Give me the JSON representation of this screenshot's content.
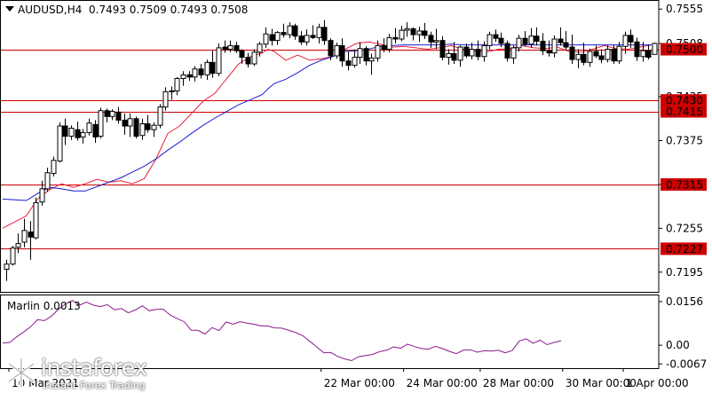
{
  "header": {
    "symbol": "AUDUSD,H4",
    "ohlc": "0.7493 0.7509 0.7493 0.7508"
  },
  "indicator": {
    "label": "Marlin 0.0013"
  },
  "logo": {
    "name": "instaforex",
    "tagline": "Instant Forex Trading"
  },
  "colors": {
    "background": "#ffffff",
    "axis": "#000000",
    "candle_up": "#ffffff",
    "candle_down": "#000000",
    "level_line": "#cc0000",
    "level_label_bg": "#cc0000",
    "ma_fast": "#e8213a",
    "ma_slow": "#1a1ad6",
    "oscillator": "#8b1a8b"
  },
  "chart_data": [
    {
      "type": "candlestick",
      "title": "AUDUSD,H4",
      "ylim": [
        0.7168,
        0.7565
      ],
      "price_ticks": [
        "0.7555",
        "0.7435",
        "0.7375",
        "0.7315",
        "0.7255",
        "0.7195"
      ],
      "x_ticks": [
        {
          "label": "10 Mar 2021",
          "at": 0
        },
        {
          "label": "22 Mar 00:00",
          "at": 53
        },
        {
          "label": "24 Mar 00:00",
          "at": 67
        },
        {
          "label": "28 Mar 00:00",
          "at": 80
        },
        {
          "label": "30 Mar 00:00",
          "at": 94
        },
        {
          "label": "1 Apr 00:00",
          "at": 108
        }
      ],
      "levels": [
        {
          "value": 0.75,
          "label": "0.7500"
        },
        {
          "value": 0.743,
          "label": "0.7430"
        },
        {
          "value": 0.7415,
          "label": "0.7415"
        },
        {
          "value": 0.7315,
          "label": "0.7315"
        },
        {
          "value": 0.7227,
          "label": "0.7227"
        }
      ],
      "current_price": {
        "value": 0.7508,
        "label": "0.7508"
      },
      "candles": [
        [
          0.7199,
          0.7212,
          0.7183,
          0.7206
        ],
        [
          0.7206,
          0.7231,
          0.7204,
          0.7228
        ],
        [
          0.7229,
          0.7248,
          0.7221,
          0.7234
        ],
        [
          0.7236,
          0.7268,
          0.7229,
          0.7252
        ],
        [
          0.725,
          0.7265,
          0.7212,
          0.7243
        ],
        [
          0.7242,
          0.7297,
          0.724,
          0.729
        ],
        [
          0.7291,
          0.732,
          0.7286,
          0.7309
        ],
        [
          0.7309,
          0.7338,
          0.7305,
          0.7331
        ],
        [
          0.733,
          0.7353,
          0.7326,
          0.7348
        ],
        [
          0.7347,
          0.74,
          0.7345,
          0.7395
        ],
        [
          0.7395,
          0.7405,
          0.7369,
          0.7381
        ],
        [
          0.7381,
          0.7396,
          0.7376,
          0.7392
        ],
        [
          0.739,
          0.7401,
          0.7375,
          0.7379
        ],
        [
          0.738,
          0.7391,
          0.7371,
          0.7386
        ],
        [
          0.7386,
          0.7405,
          0.7382,
          0.7399
        ],
        [
          0.7397,
          0.7403,
          0.7372,
          0.738
        ],
        [
          0.7381,
          0.742,
          0.7378,
          0.7416
        ],
        [
          0.7416,
          0.7419,
          0.74,
          0.7408
        ],
        [
          0.7408,
          0.7418,
          0.7403,
          0.7415
        ],
        [
          0.7414,
          0.7421,
          0.7398,
          0.7403
        ],
        [
          0.7403,
          0.7412,
          0.7383,
          0.7395
        ],
        [
          0.7395,
          0.7412,
          0.738,
          0.7405
        ],
        [
          0.7405,
          0.7408,
          0.7378,
          0.7381
        ],
        [
          0.7382,
          0.7405,
          0.7376,
          0.7398
        ],
        [
          0.7398,
          0.741,
          0.7386,
          0.739
        ],
        [
          0.739,
          0.74,
          0.738,
          0.7396
        ],
        [
          0.7396,
          0.7425,
          0.7392,
          0.7421
        ],
        [
          0.7421,
          0.7448,
          0.7416,
          0.7442
        ],
        [
          0.7442,
          0.7449,
          0.7431,
          0.7443
        ],
        [
          0.7443,
          0.7462,
          0.7437,
          0.746
        ],
        [
          0.746,
          0.747,
          0.745,
          0.7465
        ],
        [
          0.7465,
          0.747,
          0.7457,
          0.7462
        ],
        [
          0.7462,
          0.7477,
          0.7456,
          0.7473
        ],
        [
          0.7473,
          0.748,
          0.746,
          0.7465
        ],
        [
          0.7465,
          0.7486,
          0.7458,
          0.7482
        ],
        [
          0.7482,
          0.7498,
          0.7461,
          0.7467
        ],
        [
          0.7467,
          0.7508,
          0.7463,
          0.7502
        ],
        [
          0.7503,
          0.7512,
          0.7495,
          0.75
        ],
        [
          0.75,
          0.7512,
          0.7496,
          0.7505
        ],
        [
          0.7505,
          0.751,
          0.7495,
          0.7498
        ],
        [
          0.7498,
          0.75,
          0.748,
          0.7489
        ],
        [
          0.7489,
          0.7495,
          0.7475,
          0.748
        ],
        [
          0.748,
          0.75,
          0.7477,
          0.7496
        ],
        [
          0.7496,
          0.751,
          0.749,
          0.7507
        ],
        [
          0.7507,
          0.753,
          0.7502,
          0.7521
        ],
        [
          0.752,
          0.7528,
          0.7505,
          0.7512
        ],
        [
          0.7512,
          0.7525,
          0.7506,
          0.7523
        ],
        [
          0.7523,
          0.7535,
          0.7516,
          0.752
        ],
        [
          0.752,
          0.7537,
          0.7515,
          0.7532
        ],
        [
          0.7532,
          0.7535,
          0.7513,
          0.7518
        ],
        [
          0.7518,
          0.7525,
          0.7506,
          0.751
        ],
        [
          0.751,
          0.7527,
          0.7505,
          0.7519
        ],
        [
          0.7519,
          0.7533,
          0.7514,
          0.7516
        ],
        [
          0.7516,
          0.7535,
          0.7508,
          0.753
        ],
        [
          0.753,
          0.754,
          0.7506,
          0.7512
        ],
        [
          0.7512,
          0.7515,
          0.7485,
          0.7491
        ],
        [
          0.7491,
          0.7509,
          0.7487,
          0.7505
        ],
        [
          0.7505,
          0.7515,
          0.7476,
          0.7484
        ],
        [
          0.7484,
          0.7497,
          0.7471,
          0.7478
        ],
        [
          0.7478,
          0.75,
          0.7475,
          0.7489
        ],
        [
          0.7489,
          0.751,
          0.748,
          0.7501
        ],
        [
          0.7501,
          0.7504,
          0.7478,
          0.7484
        ],
        [
          0.7484,
          0.7494,
          0.7465,
          0.7488
        ],
        [
          0.7488,
          0.7512,
          0.7483,
          0.7505
        ],
        [
          0.7505,
          0.7515,
          0.7496,
          0.75
        ],
        [
          0.75,
          0.7521,
          0.7496,
          0.7516
        ],
        [
          0.7516,
          0.7529,
          0.7508,
          0.7514
        ],
        [
          0.7514,
          0.7532,
          0.7511,
          0.7526
        ],
        [
          0.7526,
          0.7537,
          0.7517,
          0.7528
        ],
        [
          0.7528,
          0.753,
          0.7512,
          0.752
        ],
        [
          0.752,
          0.7531,
          0.751,
          0.7525
        ],
        [
          0.7525,
          0.7536,
          0.7514,
          0.7519
        ],
        [
          0.7519,
          0.7524,
          0.7502,
          0.751
        ],
        [
          0.751,
          0.7528,
          0.75,
          0.7512
        ],
        [
          0.7512,
          0.7518,
          0.7485,
          0.7489
        ],
        [
          0.7489,
          0.75,
          0.7479,
          0.7494
        ],
        [
          0.7494,
          0.751,
          0.748,
          0.7485
        ],
        [
          0.7485,
          0.7505,
          0.7476,
          0.7503
        ],
        [
          0.7503,
          0.7508,
          0.7488,
          0.7491
        ],
        [
          0.7491,
          0.7509,
          0.7486,
          0.75
        ],
        [
          0.75,
          0.7512,
          0.7485,
          0.749
        ],
        [
          0.749,
          0.7511,
          0.7483,
          0.7505
        ],
        [
          0.7505,
          0.7524,
          0.75,
          0.752
        ],
        [
          0.752,
          0.7527,
          0.751,
          0.7515
        ],
        [
          0.7515,
          0.7523,
          0.7503,
          0.7508
        ],
        [
          0.7508,
          0.7512,
          0.7483,
          0.7488
        ],
        [
          0.7488,
          0.7505,
          0.748,
          0.7502
        ],
        [
          0.7502,
          0.752,
          0.7497,
          0.7515
        ],
        [
          0.7515,
          0.7525,
          0.7504,
          0.7507
        ],
        [
          0.7507,
          0.7529,
          0.7502,
          0.7518
        ],
        [
          0.7518,
          0.753,
          0.7505,
          0.7511
        ],
        [
          0.7511,
          0.7522,
          0.7492,
          0.7498
        ],
        [
          0.7498,
          0.7512,
          0.749,
          0.7495
        ],
        [
          0.7495,
          0.7519,
          0.7489,
          0.7514
        ],
        [
          0.7514,
          0.753,
          0.7505,
          0.7509
        ],
        [
          0.7509,
          0.7525,
          0.7498,
          0.7503
        ],
        [
          0.7503,
          0.752,
          0.748,
          0.7486
        ],
        [
          0.7486,
          0.75,
          0.7474,
          0.7493
        ],
        [
          0.7493,
          0.7509,
          0.7478,
          0.7482
        ],
        [
          0.7482,
          0.7501,
          0.7476,
          0.7497
        ],
        [
          0.7497,
          0.7505,
          0.7488,
          0.7491
        ],
        [
          0.7491,
          0.75,
          0.7481,
          0.7486
        ],
        [
          0.7486,
          0.7505,
          0.7482,
          0.75
        ],
        [
          0.75,
          0.7506,
          0.748,
          0.7484
        ],
        [
          0.7484,
          0.751,
          0.748,
          0.7504
        ],
        [
          0.7504,
          0.7524,
          0.7494,
          0.7519
        ],
        [
          0.7519,
          0.7527,
          0.7502,
          0.751
        ],
        [
          0.751,
          0.7516,
          0.7484,
          0.749
        ],
        [
          0.749,
          0.751,
          0.7483,
          0.7498
        ],
        [
          0.7498,
          0.7506,
          0.7486,
          0.7489
        ],
        [
          0.7493,
          0.7509,
          0.7493,
          0.7508
        ]
      ],
      "ma_fast": [
        [
          0,
          0.7255
        ],
        [
          8,
          0.7272
        ],
        [
          12,
          0.7296
        ],
        [
          16,
          0.7308
        ],
        [
          20,
          0.7316
        ],
        [
          24,
          0.7311
        ],
        [
          28,
          0.7316
        ],
        [
          32,
          0.7322
        ],
        [
          36,
          0.7318
        ],
        [
          40,
          0.732
        ],
        [
          44,
          0.7316
        ],
        [
          48,
          0.7323
        ],
        [
          52,
          0.735
        ],
        [
          56,
          0.7385
        ],
        [
          60,
          0.7395
        ],
        [
          64,
          0.7412
        ],
        [
          68,
          0.7429
        ],
        [
          72,
          0.744
        ],
        [
          76,
          0.746
        ],
        [
          80,
          0.748
        ],
        [
          84,
          0.749
        ],
        [
          88,
          0.7495
        ],
        [
          90,
          0.75
        ],
        [
          92,
          0.7497
        ],
        [
          96,
          0.7485
        ],
        [
          100,
          0.7492
        ],
        [
          104,
          0.7485
        ],
        [
          108,
          0.7487
        ],
        [
          112,
          0.749
        ],
        [
          116,
          0.75
        ],
        [
          120,
          0.7508
        ],
        [
          124,
          0.751
        ],
        [
          128,
          0.7507
        ],
        [
          132,
          0.7503
        ],
        [
          136,
          0.7504
        ],
        [
          140,
          0.7502
        ],
        [
          144,
          0.75
        ],
        [
          148,
          0.7502
        ],
        [
          152,
          0.7505
        ],
        [
          156,
          0.75
        ],
        [
          160,
          0.7498
        ],
        [
          164,
          0.7496
        ],
        [
          168,
          0.75
        ],
        [
          172,
          0.7501
        ],
        [
          176,
          0.7505
        ],
        [
          180,
          0.7502
        ],
        [
          184,
          0.7501
        ],
        [
          188,
          0.7503
        ],
        [
          192,
          0.7497
        ],
        [
          196,
          0.7496
        ],
        [
          200,
          0.75
        ],
        [
          204,
          0.7505
        ],
        [
          208,
          0.7501
        ],
        [
          212,
          0.75
        ],
        [
          216,
          0.7503
        ],
        [
          220,
          0.7506
        ]
      ],
      "ma_slow": [
        [
          0,
          0.7295
        ],
        [
          8,
          0.7293
        ],
        [
          12,
          0.7303
        ],
        [
          16,
          0.7311
        ],
        [
          20,
          0.7309
        ],
        [
          24,
          0.7306
        ],
        [
          28,
          0.7306
        ],
        [
          32,
          0.7312
        ],
        [
          36,
          0.7318
        ],
        [
          40,
          0.7324
        ],
        [
          44,
          0.7332
        ],
        [
          48,
          0.734
        ],
        [
          52,
          0.735
        ],
        [
          56,
          0.7362
        ],
        [
          60,
          0.7373
        ],
        [
          64,
          0.7385
        ],
        [
          68,
          0.7396
        ],
        [
          72,
          0.7406
        ],
        [
          76,
          0.7415
        ],
        [
          80,
          0.7424
        ],
        [
          84,
          0.7431
        ],
        [
          88,
          0.7438
        ],
        [
          90,
          0.7446
        ],
        [
          92,
          0.7453
        ],
        [
          96,
          0.7459
        ],
        [
          100,
          0.7468
        ],
        [
          104,
          0.7478
        ],
        [
          108,
          0.7485
        ],
        [
          112,
          0.749
        ],
        [
          116,
          0.7497
        ],
        [
          120,
          0.7498
        ],
        [
          124,
          0.75
        ],
        [
          128,
          0.7504
        ],
        [
          132,
          0.7505
        ],
        [
          136,
          0.7506
        ],
        [
          140,
          0.7506
        ],
        [
          144,
          0.7506
        ],
        [
          148,
          0.7506
        ],
        [
          152,
          0.7507
        ],
        [
          156,
          0.7506
        ],
        [
          160,
          0.7506
        ],
        [
          164,
          0.7506
        ],
        [
          168,
          0.7506
        ],
        [
          172,
          0.7506
        ],
        [
          176,
          0.7506
        ],
        [
          180,
          0.7506
        ],
        [
          184,
          0.7506
        ],
        [
          188,
          0.7506
        ],
        [
          192,
          0.7506
        ],
        [
          196,
          0.7506
        ],
        [
          200,
          0.7506
        ],
        [
          204,
          0.7506
        ],
        [
          208,
          0.7506
        ],
        [
          212,
          0.7506
        ],
        [
          216,
          0.7506
        ],
        [
          220,
          0.7506
        ]
      ]
    },
    {
      "type": "line",
      "title": "Marlin 0.0013",
      "ylim": [
        -0.0082,
        0.0178
      ],
      "y_ticks": [
        "0.0156",
        "0.00",
        "-0.0067"
      ],
      "series": [
        {
          "name": "Marlin",
          "values": [
            0.0008,
            0.001,
            0.003,
            0.0047,
            0.0066,
            0.0091,
            0.0088,
            0.0104,
            0.0129,
            0.0148,
            0.016,
            0.0143,
            0.0154,
            0.0143,
            0.0138,
            0.0145,
            0.0127,
            0.0131,
            0.0116,
            0.0126,
            0.0141,
            0.0123,
            0.0128,
            0.0129,
            0.0108,
            0.0095,
            0.0084,
            0.0054,
            0.0053,
            0.004,
            0.0063,
            0.0052,
            0.0083,
            0.0075,
            0.0084,
            0.0079,
            0.0075,
            0.0069,
            0.0069,
            0.0062,
            0.0061,
            0.0053,
            0.0045,
            0.0034,
            0.0014,
            -0.0006,
            -0.0027,
            -0.0026,
            -0.004,
            -0.0049,
            -0.0055,
            -0.0041,
            -0.0037,
            -0.0033,
            -0.0023,
            -0.0018,
            -0.0006,
            -0.0011,
            0.0004,
            -0.0005,
            -0.0012,
            -0.0014,
            -0.0004,
            -0.0012,
            -0.0022,
            -0.003,
            -0.0018,
            -0.0016,
            -0.0025,
            -0.002,
            -0.0021,
            -0.0018,
            -0.0027,
            -0.0019,
            0.0015,
            0.0023,
            0.0007,
            0.0018,
            0.0002,
            0.001,
            0.0016
          ]
        }
      ]
    }
  ]
}
